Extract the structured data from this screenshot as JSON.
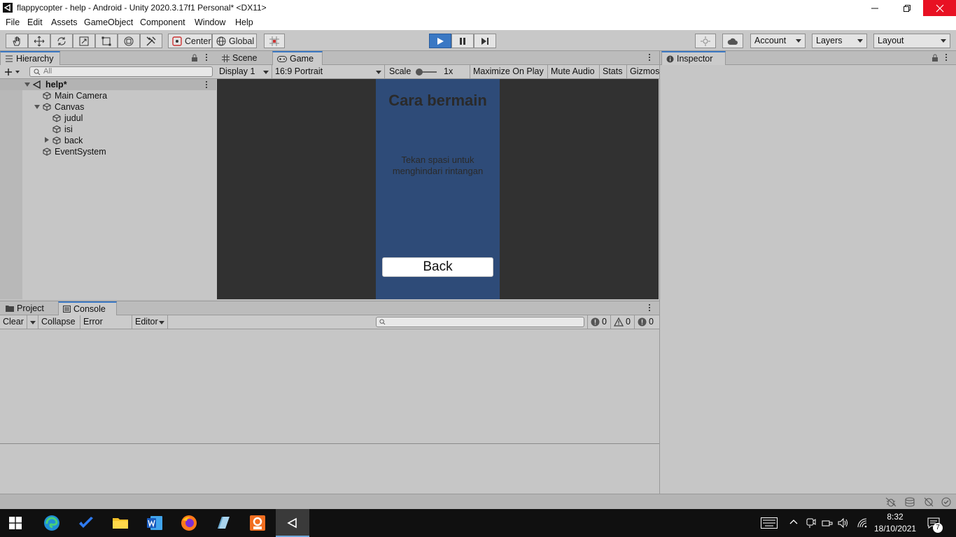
{
  "window": {
    "title": "flappycopter - help - Android - Unity 2020.3.17f1 Personal* <DX11>"
  },
  "menu": [
    "File",
    "Edit",
    "Assets",
    "GameObject",
    "Component",
    "Window",
    "Help"
  ],
  "toolbar": {
    "pivot_label": "Center",
    "space_label": "Global",
    "account_label": "Account",
    "layers_label": "Layers",
    "layout_label": "Layout",
    "play_active": true
  },
  "hierarchy": {
    "tab_label": "Hierarchy",
    "search_placeholder": "All",
    "scene_name": "help*",
    "items": [
      {
        "label": "Main Camera"
      },
      {
        "label": "Canvas"
      },
      {
        "label": "judul"
      },
      {
        "label": "isi"
      },
      {
        "label": "back"
      },
      {
        "label": "EventSystem"
      }
    ]
  },
  "scene_tabs": {
    "scene_label": "Scene",
    "game_label": "Game"
  },
  "game_toolbar": {
    "display": "Display 1",
    "aspect": "16:9 Portrait",
    "scale_label": "Scale",
    "scale_value": "1x",
    "maximize": "Maximize On Play",
    "mute": "Mute Audio",
    "stats": "Stats",
    "gizmos": "Gizmos"
  },
  "game_view": {
    "title_text": "Cara bermain",
    "body_text": "Tekan spasi untuk menghindari rintangan",
    "button_text": "Back",
    "bg_color": "#2e4b78"
  },
  "inspector": {
    "tab_label": "Inspector"
  },
  "bottom_tabs": {
    "project_label": "Project",
    "console_label": "Console"
  },
  "console_toolbar": {
    "clear": "Clear",
    "collapse": "Collapse",
    "error_pause": "Error Pause",
    "editor": "Editor",
    "error_count": "0",
    "warning_count": "0",
    "info_count": "0"
  },
  "taskbar": {
    "time": "8:32",
    "date": "18/10/2021",
    "notification_count": "7"
  },
  "colors": {
    "accent": "#3a78c4",
    "panel": "#c6c6c6",
    "viewport": "#313131"
  }
}
